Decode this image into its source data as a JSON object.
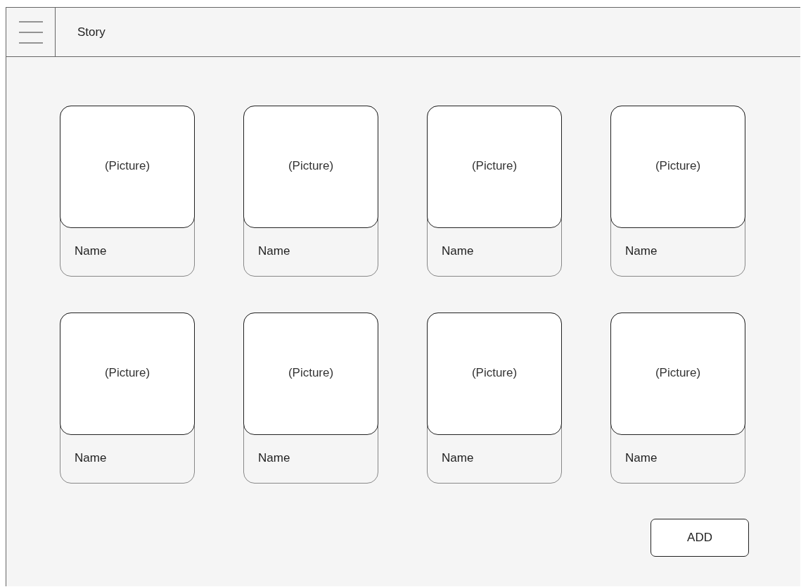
{
  "header": {
    "title": "Story"
  },
  "cards": [
    {
      "picture_label": "(Picture)",
      "name": "Name"
    },
    {
      "picture_label": "(Picture)",
      "name": "Name"
    },
    {
      "picture_label": "(Picture)",
      "name": "Name"
    },
    {
      "picture_label": "(Picture)",
      "name": "Name"
    },
    {
      "picture_label": "(Picture)",
      "name": "Name"
    },
    {
      "picture_label": "(Picture)",
      "name": "Name"
    },
    {
      "picture_label": "(Picture)",
      "name": "Name"
    },
    {
      "picture_label": "(Picture)",
      "name": "Name"
    }
  ],
  "add_button": {
    "label": "ADD"
  }
}
